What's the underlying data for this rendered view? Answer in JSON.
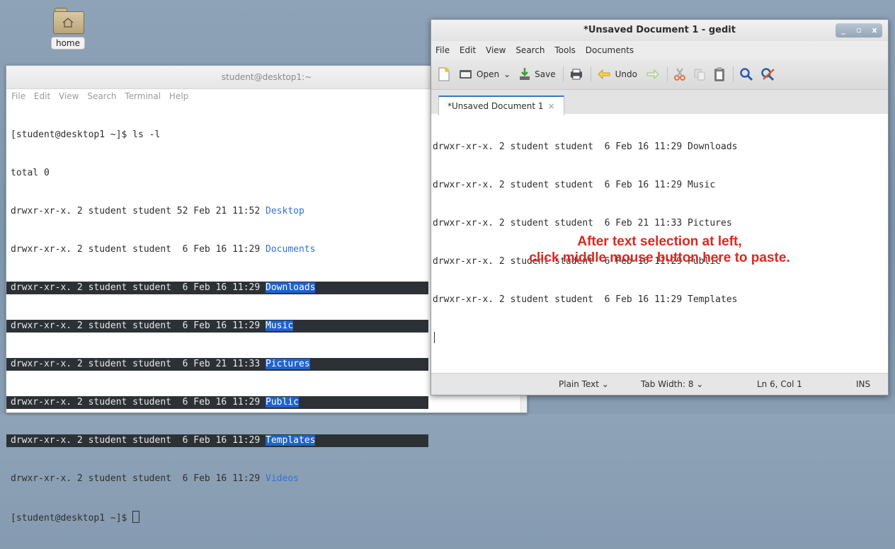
{
  "desktop": {
    "icon_label": "home"
  },
  "terminal": {
    "title": "student@desktop1:~",
    "menu": [
      "File",
      "Edit",
      "View",
      "Search",
      "Terminal",
      "Help"
    ],
    "prompt_command": "[student@desktop1 ~]$ ls -l",
    "total": "total 0",
    "entries": [
      {
        "prefix": "drwxr-xr-x. 2 student student 52 Feb 21 11:52 ",
        "name": "Desktop",
        "selected": false
      },
      {
        "prefix": "drwxr-xr-x. 2 student student  6 Feb 16 11:29 ",
        "name": "Documents",
        "selected": false
      },
      {
        "prefix": "drwxr-xr-x. 2 student student  6 Feb 16 11:29 ",
        "name": "Downloads",
        "selected": true
      },
      {
        "prefix": "drwxr-xr-x. 2 student student  6 Feb 16 11:29 ",
        "name": "Music",
        "selected": true
      },
      {
        "prefix": "drwxr-xr-x. 2 student student  6 Feb 21 11:33 ",
        "name": "Pictures",
        "selected": true
      },
      {
        "prefix": "drwxr-xr-x. 2 student student  6 Feb 16 11:29 ",
        "name": "Public",
        "selected": true
      },
      {
        "prefix": "drwxr-xr-x. 2 student student  6 Feb 16 11:29 ",
        "name": "Templates",
        "selected": true
      },
      {
        "prefix": "drwxr-xr-x. 2 student student  6 Feb 16 11:29 ",
        "name": "Videos",
        "selected": false
      }
    ],
    "prompt_end": "[student@desktop1 ~]$ "
  },
  "gedit": {
    "title": "*Unsaved Document 1 - gedit",
    "window_controls": [
      "_",
      "▫",
      "x"
    ],
    "menu": [
      "File",
      "Edit",
      "View",
      "Search",
      "Tools",
      "Documents"
    ],
    "toolbar": {
      "open": "Open",
      "save": "Save",
      "undo": "Undo"
    },
    "tab_label": "*Unsaved Document 1",
    "lines": [
      "drwxr-xr-x. 2 student student  6 Feb 16 11:29 Downloads",
      "drwxr-xr-x. 2 student student  6 Feb 16 11:29 Music",
      "drwxr-xr-x. 2 student student  6 Feb 21 11:33 Pictures",
      "drwxr-xr-x. 2 student student  6 Feb 16 11:29 Public",
      "drwxr-xr-x. 2 student student  6 Feb 16 11:29 Templates"
    ],
    "status": {
      "language": "Plain Text ⌄",
      "tab_width": "Tab Width:  8 ⌄",
      "position": "Ln 6, Col 1",
      "mode": "INS"
    }
  },
  "annotation": {
    "line1": "After text selection at left,",
    "line2": "click middle mouse button here to paste."
  }
}
